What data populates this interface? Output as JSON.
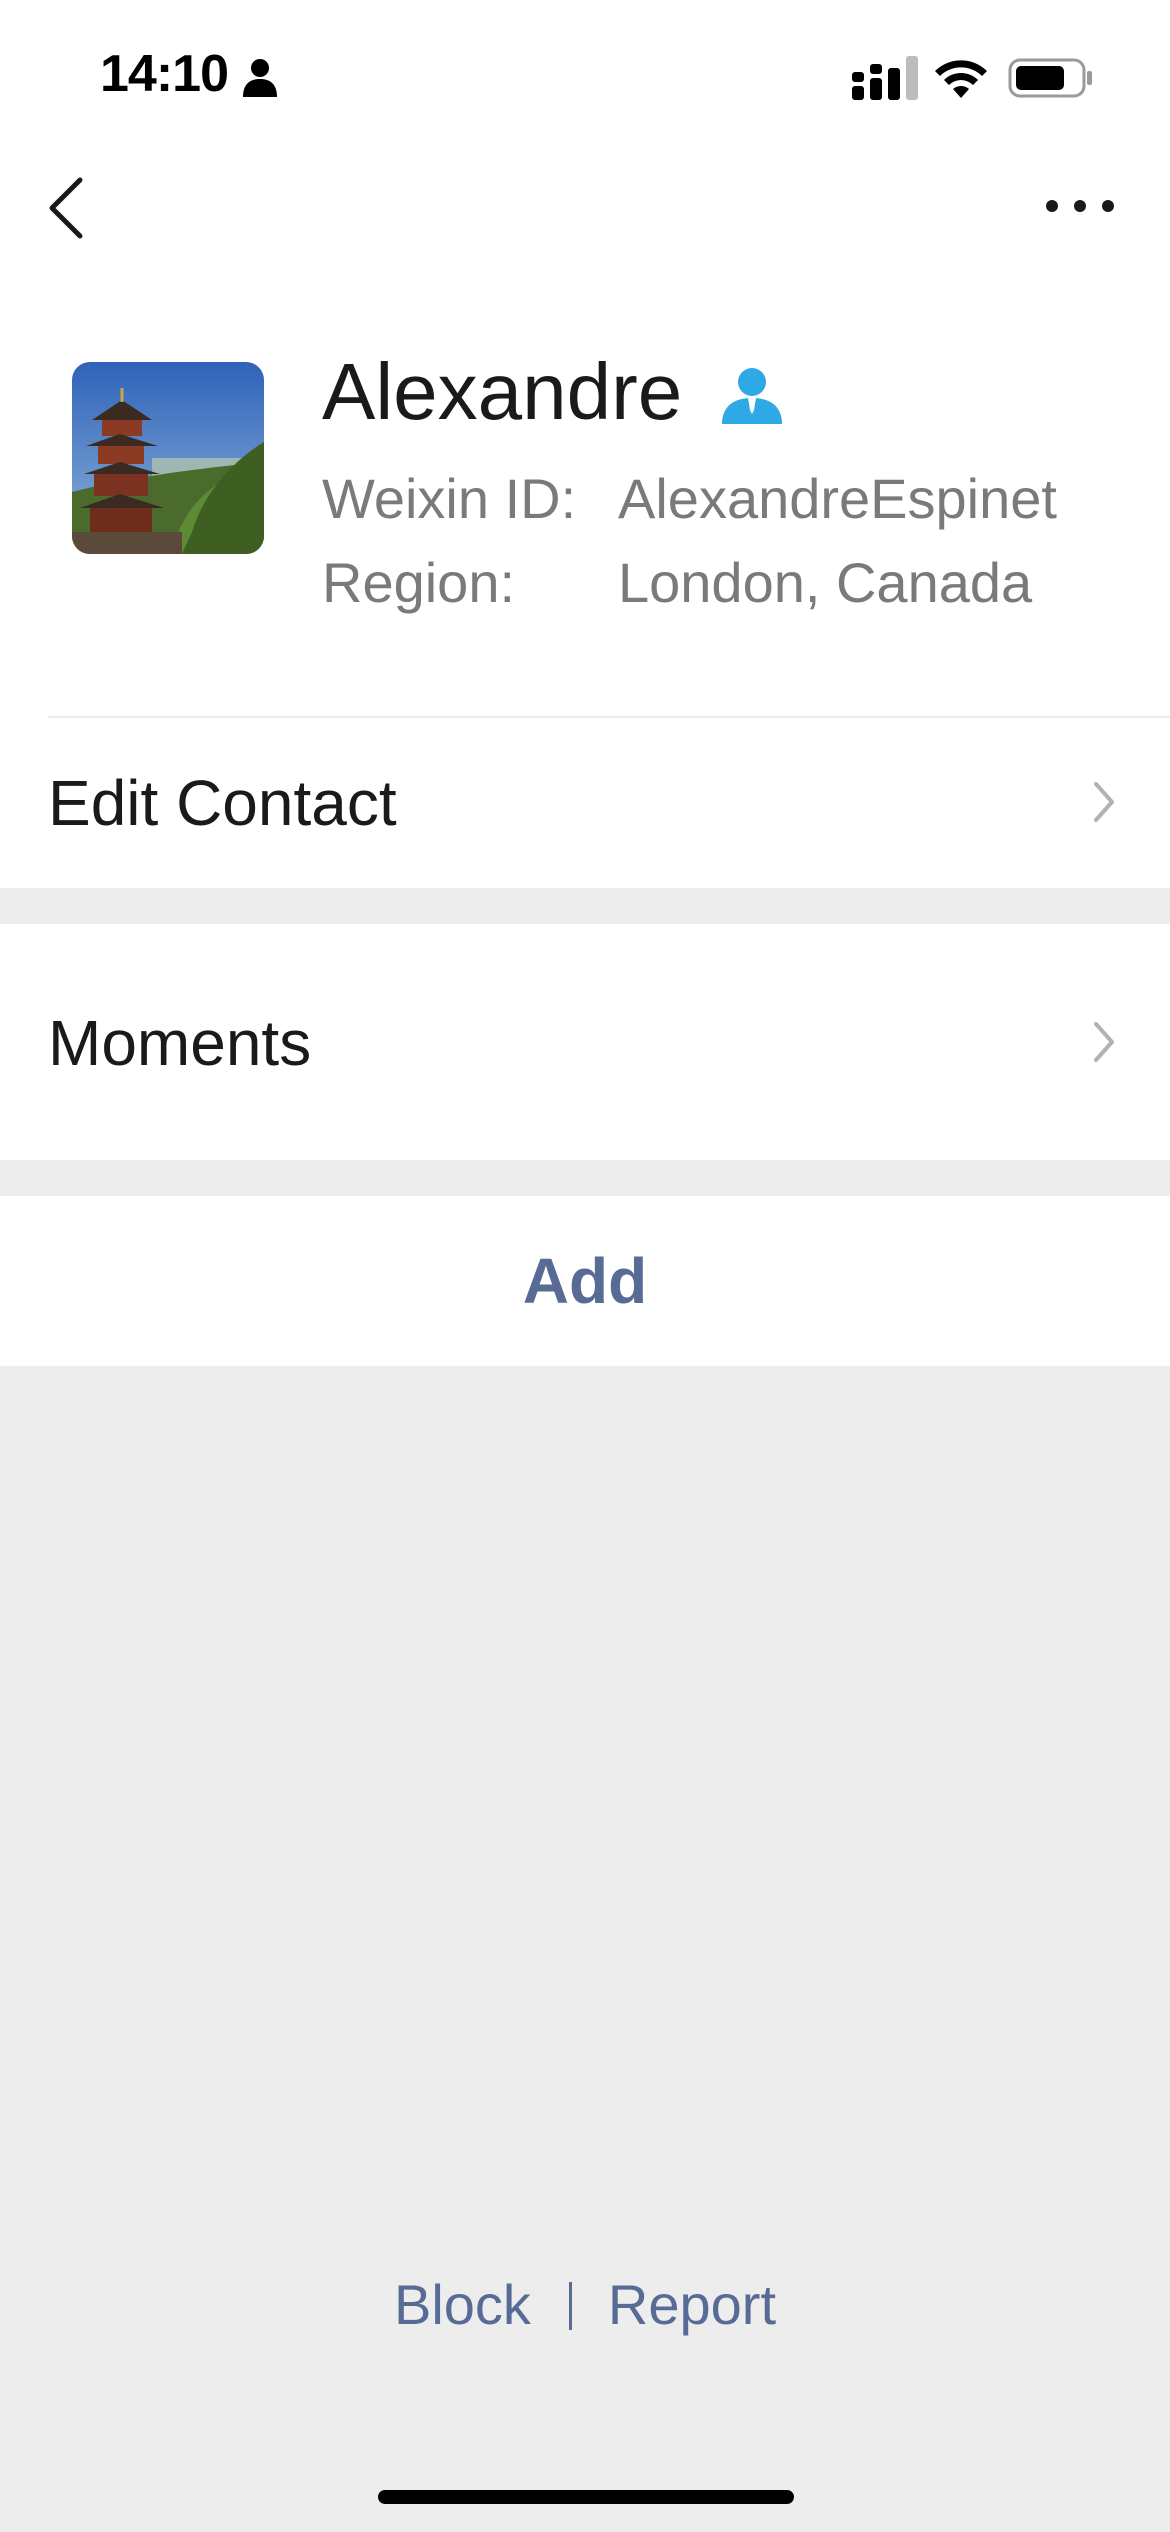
{
  "status_bar": {
    "time": "14:10",
    "person_icon": "person-fill-icon",
    "signal_icon": "cellular-signal-icon",
    "wifi_icon": "wifi-icon",
    "battery_icon": "battery-icon"
  },
  "nav": {
    "back_icon": "chevron-left-icon",
    "more_icon": "more-horizontal-icon"
  },
  "profile": {
    "avatar_icon": "pagoda-photo-avatar",
    "name": "Alexandre",
    "contact_badge_icon": "contact-person-icon",
    "contact_badge_color": "#2fa8e6",
    "weixin_id_label": "Weixin ID:",
    "weixin_id_value": "AlexandreEspinet",
    "region_label": "Region:",
    "region_value": "London, Canada"
  },
  "menu": {
    "edit_contact_label": "Edit Contact",
    "moments_label": "Moments",
    "add_label": "Add"
  },
  "footer": {
    "block_label": "Block",
    "report_label": "Report"
  },
  "colors": {
    "link_blue": "#576b95",
    "background_gray": "#ededed",
    "secondary_text": "#7a7a7a"
  }
}
